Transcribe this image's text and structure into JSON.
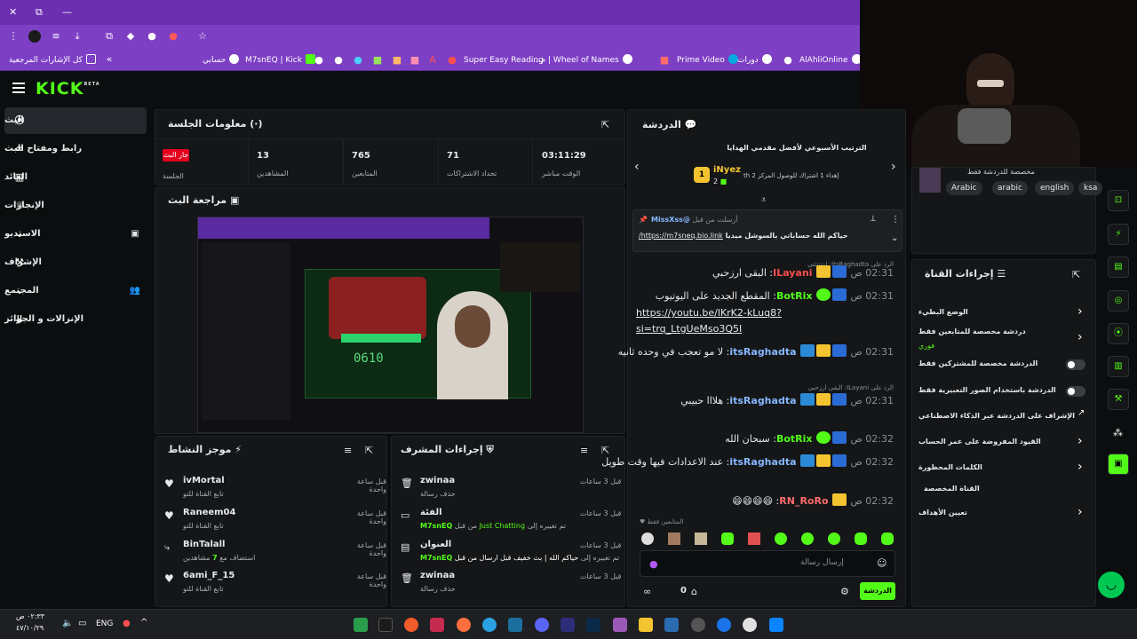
{
  "browser": {
    "window_controls": [
      "✕",
      "⧉",
      "—"
    ],
    "bookmarks": [
      {
        "label": "كل الإشارات المرجعية",
        "color": "#ffffff"
      },
      {
        "label": "حسابي",
        "color": ""
      },
      {
        "label": "M7snEQ | Kick",
        "color": "#53fc18"
      },
      {
        "label": "",
        "color": "#ffffff"
      },
      {
        "label": "",
        "color": "#4285f4"
      },
      {
        "label": "",
        "color": "#00b894"
      },
      {
        "label": "",
        "color": "#e17055"
      },
      {
        "label": "Super Easy Reading",
        "color": "#ffffff"
      },
      {
        "label": "Wheel of Names | م...",
        "color": "#ffffff"
      },
      {
        "label": "Prime Video",
        "color": "#00a8e1"
      },
      {
        "label": "دورات",
        "color": "#ffffff"
      },
      {
        "label": "AlAhliOnline",
        "color": "#ffffff"
      }
    ]
  },
  "kick": {
    "logo": "KICK",
    "logo_sup": "BETA"
  },
  "sidebar": {
    "items": [
      {
        "label": "البث",
        "icon": "broadcast-icon"
      },
      {
        "label": "رابط ومفتاح البث",
        "icon": "link-icon"
      },
      {
        "label": "العائد",
        "icon": "revenue-icon"
      },
      {
        "label": "الإنجازات",
        "icon": "trophy-icon"
      },
      {
        "label": "الاستديو",
        "icon": "studio-icon"
      },
      {
        "label": "الإشراف",
        "icon": "hammer-icon"
      },
      {
        "label": "المجتمع",
        "icon": "community-icon"
      },
      {
        "label": "الإنزالات و الجوائز",
        "icon": "drops-icon"
      }
    ]
  },
  "session": {
    "title": "معلومات الجلسة",
    "live_badge": "جار البث",
    "live_label": "الجلسة",
    "stats": [
      {
        "value": "13",
        "label": "المشاهدين"
      },
      {
        "value": "765",
        "label": "المتابعين"
      },
      {
        "value": "71",
        "label": "تحداد الاشتراكات"
      },
      {
        "value": "03:11:29",
        "label": "الوقت مباشر"
      }
    ]
  },
  "preview": {
    "title": "مراجعة البث",
    "score": "0610"
  },
  "activity": {
    "title": "موجز النشاط",
    "items": [
      {
        "name": "ivMortal",
        "desc": "تابع القناة للتو",
        "time": "قبل ساعة واحدة",
        "icon": "heart-icon"
      },
      {
        "name": "Raneem04",
        "desc": "تابع القناة للتو",
        "time": "قبل ساعة واحدة",
        "icon": "heart-icon"
      },
      {
        "name": "BinTalall",
        "desc_pre": "استضاف مع",
        "desc_num": "7",
        "desc_post": "مشاهدين",
        "time": "قبل ساعة واحدة",
        "icon": "host-icon"
      },
      {
        "name": "6ami_F_15",
        "desc": "تابع القناة للتو",
        "time": "قبل ساعة واحدة",
        "icon": "heart-icon"
      }
    ]
  },
  "modactions": {
    "title": "إجراءات المشرف",
    "items": [
      {
        "title": "zwinaa",
        "line": "حذف رسالة",
        "time": "قبل 3 ساعات",
        "icon": "trash-icon"
      },
      {
        "title": "الفئة",
        "line_pre": "تم تغييره إلى",
        "line_val": "Just Chatting",
        "line_mid": "من قبل",
        "line_user": "M7snEQ",
        "time": "قبل 3 ساعات",
        "icon": "category-icon"
      },
      {
        "title": "العنوان",
        "line_pre": "تم تغييره إلى",
        "line_val": "حياكم الله | بث خفيف قبل ارسال من قبل",
        "line_user": "M7snEQ",
        "time": "قبل 3 ساعات",
        "icon": "title-icon"
      },
      {
        "title": "zwinaa",
        "line": "حذف رسالة",
        "time": "قبل 3 ساعات",
        "icon": "trash-icon"
      }
    ]
  },
  "chat": {
    "title": "الدردشة",
    "leader_title": "الترتيب الأسبوعي لأفضل مقدمي الهدايا",
    "leader_name": "iNyez",
    "leader_count": "2",
    "leader_rank": "1",
    "leader_note": "إهداء 1 اشتراك للوصول المركز 2 th",
    "pinned_from": "@MissXss",
    "pinned_label": "أرسلت من قبل",
    "pinned_text": "حياكم الله حساباتي بالسوشل ميديا",
    "pinned_link": "https://m7sneq.bio.link/",
    "messages": [
      {
        "reply": "الرد على itsRaghadta: ابتتتتتتي",
        "time": "02:31 ص",
        "user": "ILayani",
        "text": "البقى ارزحبي",
        "color": "#ff4d4d"
      },
      {
        "time": "02:31 ص",
        "user": "BotRix",
        "text": "المقطع الجديد على اليوتيوب",
        "link": "https://youtu.be/lKrK2-kLuq8?si=trq_LtgUeMso3Q5I",
        "color": "#53fc18"
      },
      {
        "time": "02:31 ص",
        "user": "itsRaghadta",
        "text": "لا مو تعجب في وحده ثانيه",
        "color": "#86b7ff"
      },
      {
        "reply": "الرد على ILayani: البقى ارزحبي",
        "time": "02:31 ص",
        "user": "itsRaghadta",
        "text": "هلااا حبيبي",
        "color": "#86b7ff"
      },
      {
        "time": "02:32 ص",
        "user": "BotRix",
        "text": "سبحان الله",
        "color": "#53fc18"
      },
      {
        "time": "02:32 ص",
        "user": "itsRaghadta",
        "text": "عند الاعدادات فيها وقت طويل",
        "color": "#86b7ff"
      },
      {
        "time": "02:32 ص",
        "user": "RN_RoRo",
        "text": "😄😄😄😄",
        "color": "#ff6b6b"
      }
    ],
    "followers_only": "المتابعين فقط",
    "input_placeholder": "إرسال رسالة",
    "send_label": "الدردشة",
    "points": "0"
  },
  "channel": {
    "title": "إجراءات القناة",
    "langs_label": "مخصصة للدردشة فقط",
    "tags": [
      "Arabic",
      "arabic",
      "english",
      "ksa"
    ],
    "items": [
      {
        "label": "الوضع البطيء",
        "type": "chevron"
      },
      {
        "label": "دردشة مخصصة للمتابعين فقط",
        "sub": "فوري",
        "type": "chevron"
      },
      {
        "label": "الدردشة مخصصة للمشتركين فقط",
        "type": "toggle"
      },
      {
        "label": "الدردشة باستخدام الصور التعبيرية فقط",
        "type": "toggle"
      },
      {
        "label": "الإشراف على الدردشة عبر الذكاء الاصطناعي",
        "type": "external"
      },
      {
        "label": "القيود المفروضة على عمر الحساب",
        "type": "chevron"
      },
      {
        "label": "الكلمات المحظورة",
        "type": "chevron"
      }
    ],
    "custom_title": "القناة المخصصة",
    "goals": "تعيين الأهداف"
  },
  "taskbar": {
    "lang": "ENG",
    "time": "٠٢:٣٣ ص",
    "date": "٤٧/١٠/٢٩",
    "apps": [
      "#2a9d4a",
      "#1b1b1b",
      "#f15a29",
      "#c52b4f",
      "#ff6f3c",
      "#2aa0e0",
      "#1b6f9e",
      "#5865f2",
      "#2d2d7a",
      "#0a2a4a",
      "#9b59b6",
      "#f4c430",
      "#2b6cb0",
      "#555555",
      "#1a73e8",
      "#e0e0e0",
      "#0a84ff"
    ]
  },
  "colors": {
    "accent": "#53fc18",
    "live": "#e5001f"
  }
}
